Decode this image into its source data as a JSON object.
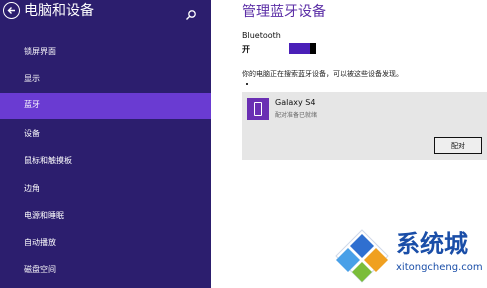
{
  "sidebar": {
    "title": "电脑和设备",
    "items": [
      {
        "label": "锁屏界面"
      },
      {
        "label": "显示"
      },
      {
        "label": "蓝牙",
        "active": true
      },
      {
        "label": "设备"
      },
      {
        "label": "鼠标和触摸板"
      },
      {
        "label": "边角"
      },
      {
        "label": "电源和睡眠"
      },
      {
        "label": "自动播放"
      },
      {
        "label": "磁盘空间"
      }
    ]
  },
  "main": {
    "title": "管理蓝牙设备",
    "bluetooth_label": "Bluetooth",
    "bluetooth_state": "开",
    "search_message": "你的电脑正在搜索蓝牙设备，可以被这些设备发现。",
    "device": {
      "name": "Galaxy S4",
      "status": "配对准备已就绪",
      "pair_label": "配对"
    }
  },
  "watermark": {
    "text": "系统城",
    "url": "xitongcheng.com"
  },
  "colors": {
    "sidebar_bg": "#2c1e6e",
    "active_item": "#6a3bd2",
    "accent": "#5b2ea6",
    "toggle": "#4a1fb8"
  },
  "icons": [
    "back-arrow-icon",
    "search-icon",
    "phone-icon"
  ]
}
